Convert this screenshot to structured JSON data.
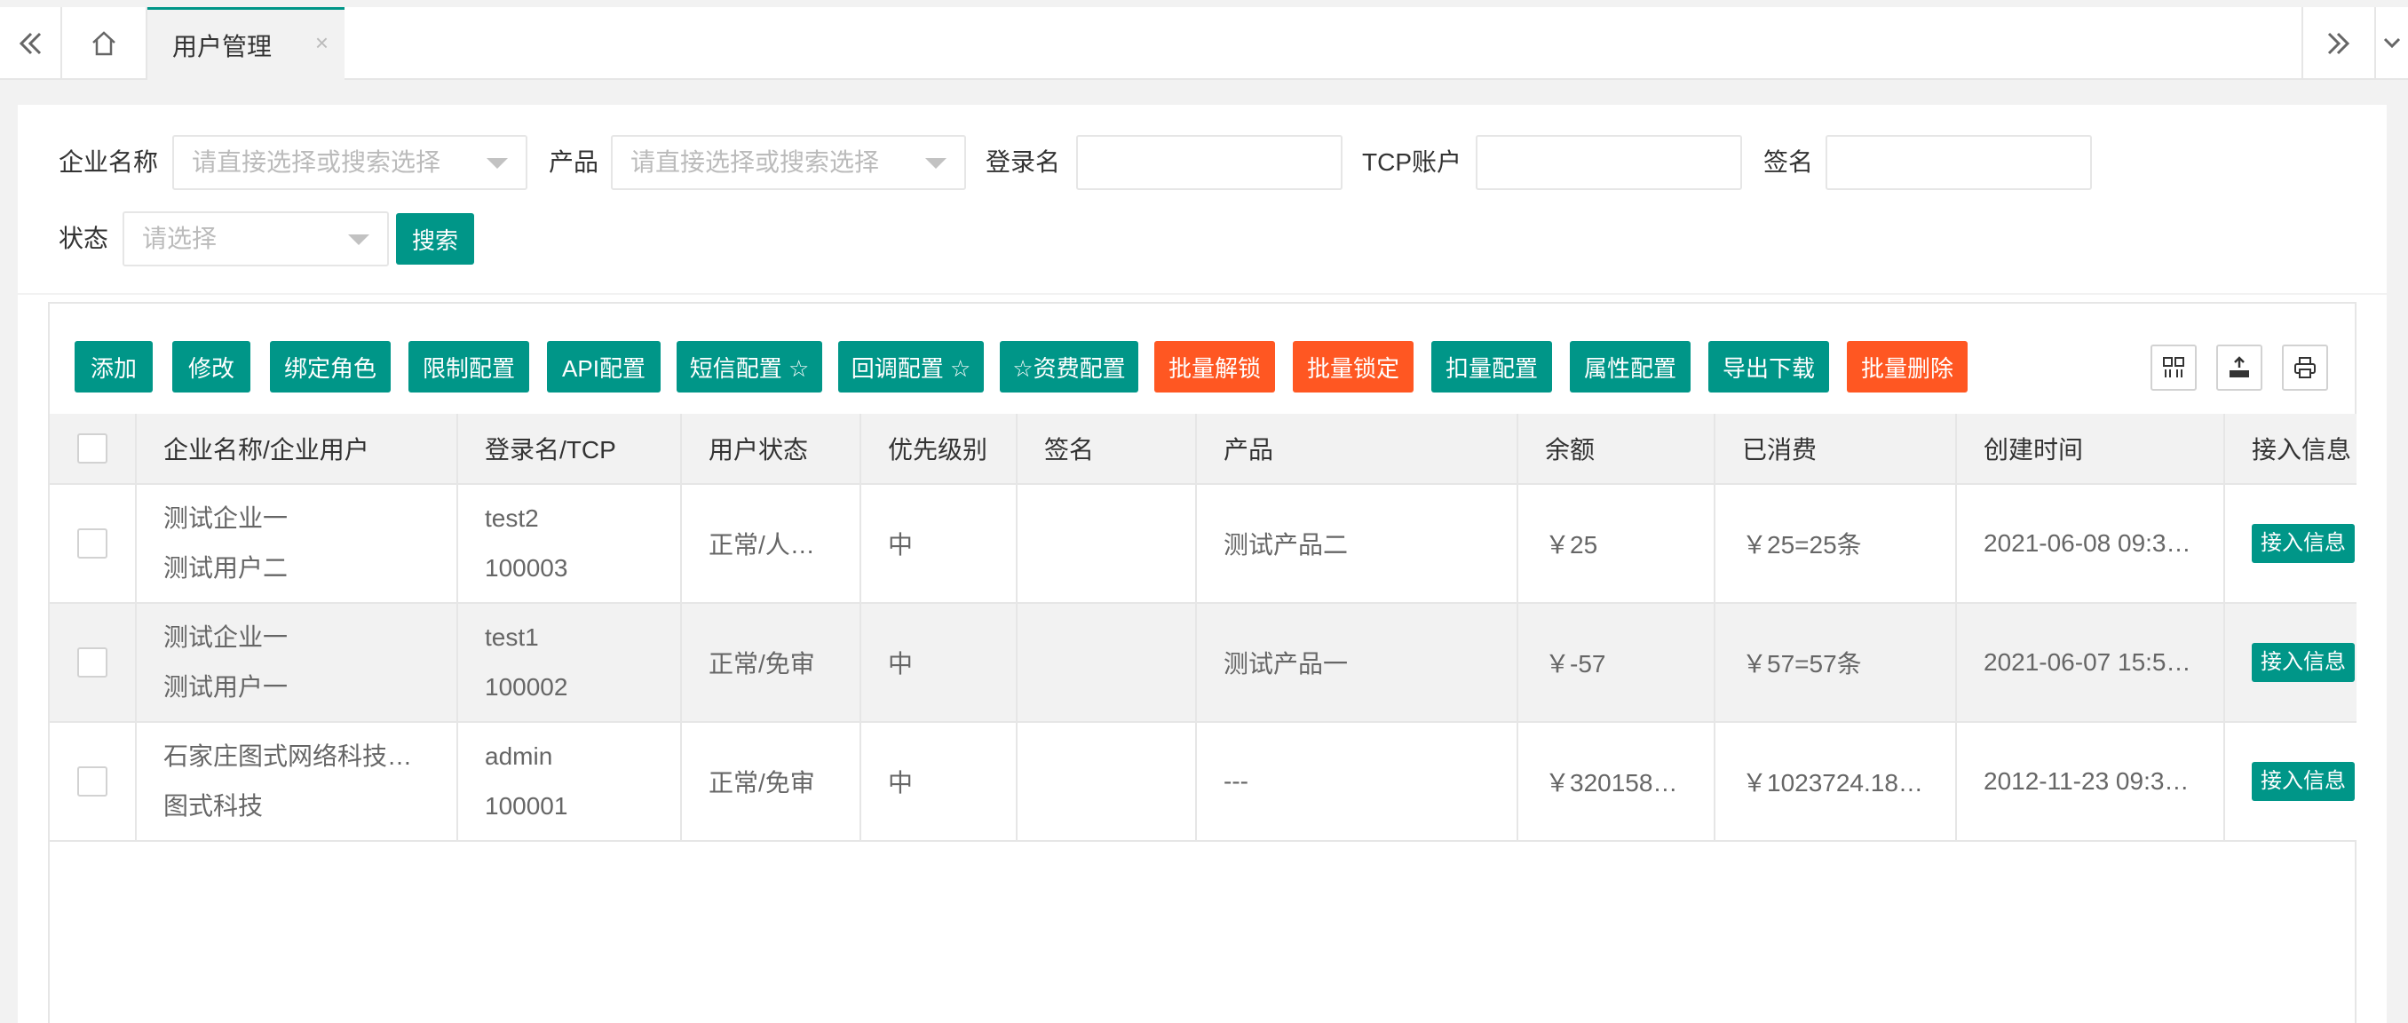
{
  "tabs": {
    "prev_icon": "double-chevron-left-icon",
    "home_icon": "home-icon",
    "active_label": "用户管理",
    "close_glyph": "×",
    "next_icon": "double-chevron-right-icon",
    "dropdown_icon": "chevron-down-icon"
  },
  "search": {
    "company_label": "企业名称",
    "company_placeholder": "请直接选择或搜索选择",
    "product_label": "产品",
    "product_placeholder": "请直接选择或搜索选择",
    "login_label": "登录名",
    "login_value": "",
    "tcp_label": "TCP账户",
    "tcp_value": "",
    "sign_label": "签名",
    "sign_value": "",
    "status_label": "状态",
    "status_placeholder": "请选择",
    "search_button": "搜索"
  },
  "toolbar": {
    "buttons": [
      {
        "label": "添加",
        "color": "#009688"
      },
      {
        "label": "修改",
        "color": "#009688"
      },
      {
        "label": "绑定角色",
        "color": "#009688"
      },
      {
        "label": "限制配置",
        "color": "#009688"
      },
      {
        "label": "API配置",
        "color": "#009688"
      },
      {
        "label": "短信配置 ☆",
        "color": "#009688"
      },
      {
        "label": "回调配置 ☆",
        "color": "#009688"
      },
      {
        "label": "☆资费配置",
        "color": "#009688"
      },
      {
        "label": "批量解锁",
        "color": "#ff5722"
      },
      {
        "label": "批量锁定",
        "color": "#ff5722"
      },
      {
        "label": "扣量配置",
        "color": "#009688"
      },
      {
        "label": "属性配置",
        "color": "#009688"
      },
      {
        "label": "导出下载",
        "color": "#009688"
      },
      {
        "label": "批量删除",
        "color": "#ff5722"
      }
    ],
    "icons": [
      "columns-filter-icon",
      "export-icon",
      "print-icon"
    ]
  },
  "table": {
    "headers": [
      "企业名称/企业用户",
      "登录名/TCP",
      "用户状态",
      "优先级别",
      "签名",
      "产品",
      "余额",
      "已消费",
      "创建时间",
      "接入信息"
    ],
    "rows": [
      {
        "company": "测试企业一",
        "user": "测试用户二",
        "login": "test2",
        "tcp": "100003",
        "status": "正常/人…",
        "priority": "中",
        "sign": "",
        "product": "测试产品二",
        "balance": "￥25",
        "consumed": "￥25=25条",
        "created": "2021-06-08 09:3…",
        "access": "接入信息"
      },
      {
        "company": "测试企业一",
        "user": "测试用户一",
        "login": "test1",
        "tcp": "100002",
        "status": "正常/免审",
        "priority": "中",
        "sign": "",
        "product": "测试产品一",
        "balance": "￥-57",
        "consumed": "￥57=57条",
        "created": "2021-06-07 15:5…",
        "access": "接入信息"
      },
      {
        "company": "石家庄图式网络科技…",
        "user": "图式科技",
        "login": "admin",
        "tcp": "100001",
        "status": "正常/免审",
        "priority": "中",
        "sign": "",
        "product": "---",
        "balance": "￥320158…",
        "consumed": "￥1023724.18…",
        "created": "2012-11-23 09:3…",
        "access": "接入信息"
      }
    ]
  },
  "colors": {
    "primary": "#009688",
    "danger": "#ff5722",
    "border": "#e6e6e6",
    "background": "#f2f2f2"
  }
}
